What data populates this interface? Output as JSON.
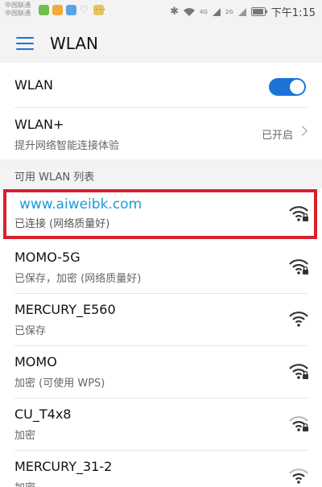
{
  "status_bar": {
    "carrier1": "中国联通",
    "carrier2": "中国联通",
    "overflow": "···",
    "time": "下午1:15",
    "net1": "4G",
    "net2": "2G"
  },
  "app_bar": {
    "title": "WLAN",
    "menu_icon": "menu-icon"
  },
  "wlan_toggle": {
    "label": "WLAN",
    "state": "on",
    "accent": "#1b73d8"
  },
  "wlan_plus": {
    "label": "WLAN+",
    "subtitle": "提升网络智能连接体验",
    "status": "已开启"
  },
  "section_header": "可用 WLAN 列表",
  "watermark": "www.aiweibk.com",
  "networks": [
    {
      "name": "www.aiweibk.com",
      "status": "已连接 (网络质量好)",
      "locked": true,
      "strength": "full"
    },
    {
      "name": "MOMO-5G",
      "status": "已保存，加密 (网络质量好)",
      "locked": true,
      "strength": "full"
    },
    {
      "name": "MERCURY_E560",
      "status": "已保存",
      "locked": false,
      "strength": "full"
    },
    {
      "name": "MOMO",
      "status": "加密 (可使用 WPS)",
      "locked": true,
      "strength": "full"
    },
    {
      "name": "CU_T4x8",
      "status": "加密",
      "locked": true,
      "strength": "weak"
    },
    {
      "name": "MERCURY_31-2",
      "status": "加密",
      "locked": true,
      "strength": "weak"
    }
  ],
  "colors": {
    "highlight_border": "#d9202c",
    "watermark": "#1e9ad6"
  }
}
